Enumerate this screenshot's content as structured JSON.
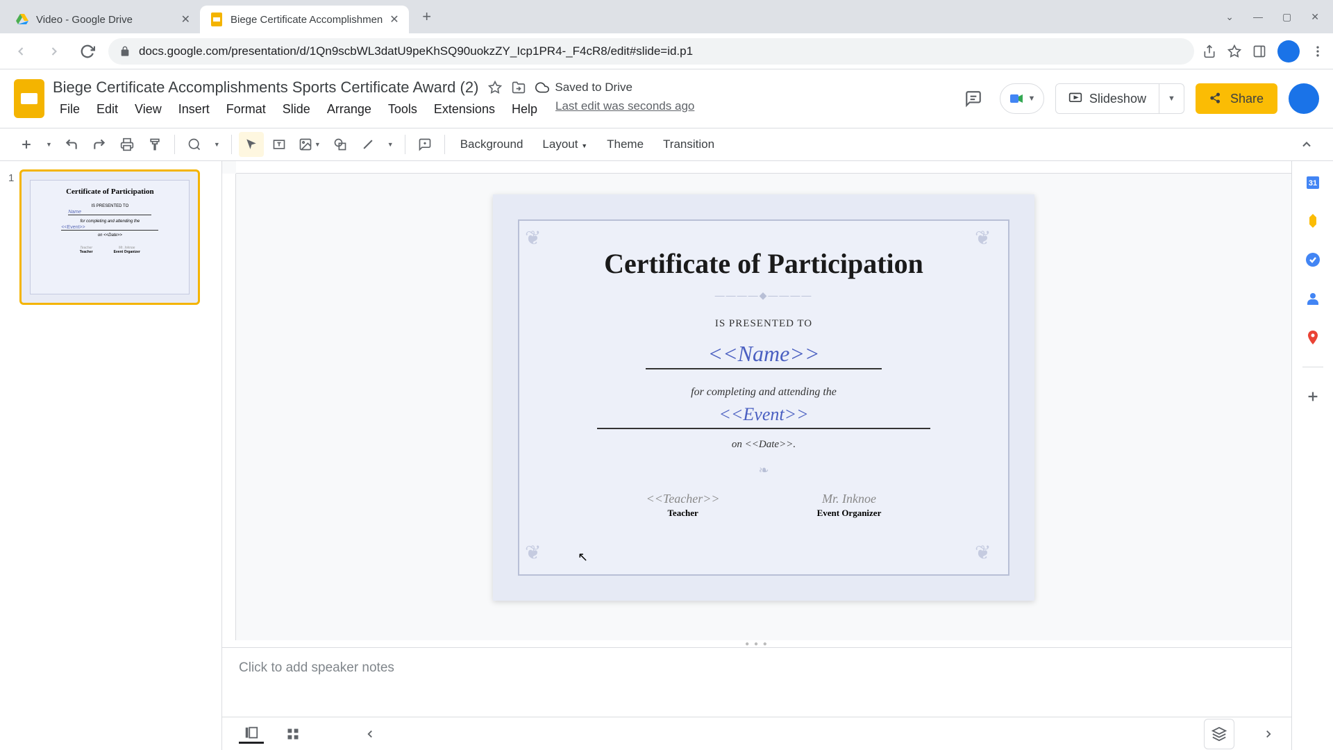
{
  "browser": {
    "tabs": [
      {
        "title": "Video - Google Drive",
        "favicon": "drive"
      },
      {
        "title": "Biege Certificate Accomplishmen",
        "favicon": "slides"
      }
    ],
    "url": "docs.google.com/presentation/d/1Qn9scbWL3datU9peKhSQ90uokzZY_Icp1PR4-_F4cR8/edit#slide=id.p1"
  },
  "doc": {
    "title": "Biege Certificate Accomplishments Sports Certificate Award (2)",
    "saved_status": "Saved to Drive",
    "last_edit": "Last edit was seconds ago"
  },
  "menus": [
    "File",
    "Edit",
    "View",
    "Insert",
    "Format",
    "Slide",
    "Arrange",
    "Tools",
    "Extensions",
    "Help"
  ],
  "header_buttons": {
    "slideshow": "Slideshow",
    "share": "Share"
  },
  "toolbar": {
    "background": "Background",
    "layout": "Layout",
    "theme": "Theme",
    "transition": "Transition"
  },
  "filmstrip": {
    "slide_number": "1",
    "thumb_title": "Certificate of Participation"
  },
  "certificate": {
    "title": "Certificate of Participation",
    "presented": "IS PRESENTED TO",
    "name": "<<Name>>",
    "completing": "for completing and attending the",
    "event": "<<Event>>",
    "date_line": "on <<Date>>.",
    "sig1_name": "<<Teacher>>",
    "sig1_role": "Teacher",
    "sig2_name": "Mr. Inknoe",
    "sig2_role": "Event Organizer"
  },
  "speaker_notes_placeholder": "Click to add speaker notes"
}
